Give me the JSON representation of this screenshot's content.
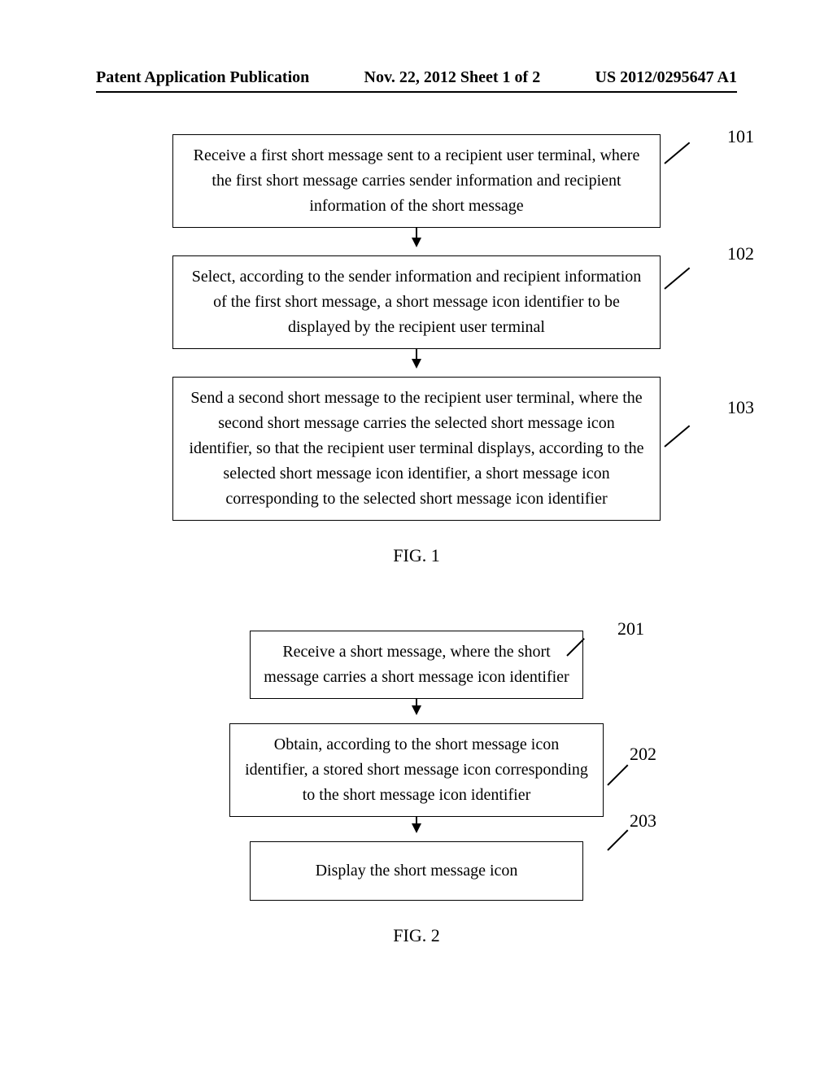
{
  "header": {
    "left": "Patent Application Publication",
    "center": "Nov. 22, 2012  Sheet 1 of 2",
    "right": "US 2012/0295647 A1"
  },
  "fig1": {
    "caption": "FIG. 1",
    "steps": [
      {
        "num": "101",
        "text": "Receive a first short message sent to a recipient user terminal, where the first short message carries sender information and recipient information of the short message"
      },
      {
        "num": "102",
        "text": "Select, according to the sender information and recipient information of the first short message, a short message icon identifier to be displayed by the recipient user terminal"
      },
      {
        "num": "103",
        "text": "Send a second short message to the recipient user terminal, where the second short message carries the selected short message icon identifier, so that the recipient user terminal displays, according to the selected short message icon identifier, a short message icon corresponding to the selected short message icon identifier"
      }
    ]
  },
  "fig2": {
    "caption": "FIG. 2",
    "steps": [
      {
        "num": "201",
        "text": "Receive a short message, where the short message carries a short message icon identifier"
      },
      {
        "num": "202",
        "text": "Obtain, according to the short message icon identifier, a stored short message icon corresponding to the short message icon identifier"
      },
      {
        "num": "203",
        "text": "Display the short message icon"
      }
    ]
  }
}
